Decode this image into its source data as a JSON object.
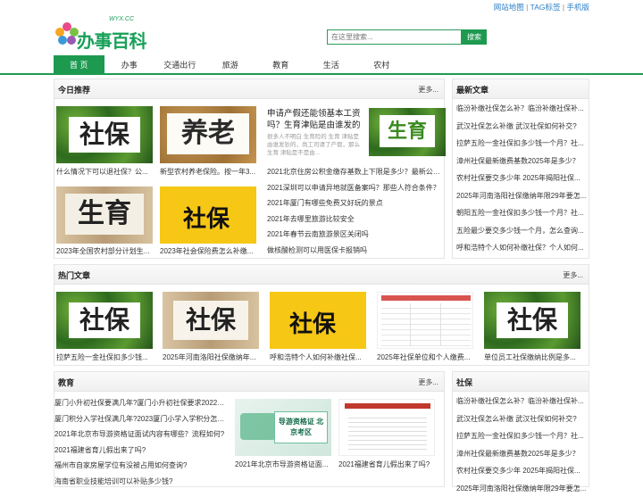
{
  "toplinks": {
    "sitemap": "网站地图",
    "tags": "TAG标签",
    "mobile": "手机版",
    "sep": "|"
  },
  "logo": {
    "text": "办事百科",
    "domain": "WYX.CC"
  },
  "search": {
    "placeholder": "在这里搜索...",
    "button": "搜索"
  },
  "nav": [
    "首 页",
    "办事",
    "交通出行",
    "旅游",
    "教育",
    "生活",
    "农村"
  ],
  "today": {
    "title": "今日推荐",
    "more": "更多...",
    "thumbs": [
      {
        "word": "社保",
        "caption": "什么情况下可以退社保？公..."
      },
      {
        "word": "养老",
        "caption": "新型农村养老保险。按一年3..."
      },
      {
        "word": "生育",
        "caption": "2023年全国农村部分计划生..."
      },
      {
        "word": "社保",
        "caption": "2023年社会保险费怎么补缴..."
      }
    ],
    "featured": {
      "title": "申请产假还能领基本工资吗？生育津贴是由谁发的哪",
      "summary": "很多人不明白 生育险的 生育 津贴是由谁发钞的，尚工司请了产假，那么 生育 津贴是不是由...",
      "word": "生育"
    },
    "list": [
      "2021北京住房公积金缴存基数上下限是多少？最新公积...",
      "2021深圳可以申请异地就医备案吗？那些人符合条件？",
      "2021年厦门有哪些免费又好玩的景点",
      "2021年去哪里旅游比较安全",
      "2021年春节云南旅游景区关闭吗",
      "做核酸检测可以用医保卡报销吗"
    ]
  },
  "latest": {
    "title": "最新文章",
    "list": [
      "临汾补缴社保怎么补？临汾补缴社保补...",
      "武汉社保怎么补缴 武汉社保如何补交?",
      "拉萨五险一金社保扣多少钱一个月？社...",
      "漳州社保最新缴费基数2025年是多少？",
      "农村社保要交多少年 2025年揭阳社保...",
      "2025年河南洛阳社保缴纳年限29年要怎...",
      "朝阳五险一金社保扣多少钱一个月？社...",
      "五险最少要交多少钱一个月，怎么查询...",
      "呼和浩特个人如何补缴社保？个人如何..."
    ]
  },
  "hot": {
    "title": "热门文章",
    "more": "更多...",
    "items": [
      {
        "word": "社保",
        "caption": "拉萨五险一金社保扣多少钱..."
      },
      {
        "word": "社保",
        "caption": "2025年河南洛阳社保缴纳年..."
      },
      {
        "word": "社保",
        "caption": "呼和浩特个人如何补缴社保..."
      },
      {
        "word": "",
        "caption": "2025年社保单位和个人缴费..."
      },
      {
        "word": "社保",
        "caption": "单位员工社保缴纳比例是多..."
      }
    ]
  },
  "edu": {
    "title": "教育",
    "more": "更多...",
    "list": [
      "厦门小升初社保要满几年?厦门小升初社保要求2022（...",
      "厦门积分入学社保满几年?2023厦门小学入学积分怎么...",
      "2021年北京市导游资格证面试内容有哪些？流程如何?",
      "2021福建省育儿假出来了吗?",
      "福州市自家房屋学位有没被占用如何查询?",
      "海南省职业技能培训可以补贴多少钱?"
    ],
    "thumbs": [
      {
        "sign": "导游资格证 北京考区",
        "caption": "2021年北京市导游资格证面..."
      },
      {
        "caption": "2021福建省育儿假出来了吗?"
      }
    ]
  },
  "shebao": {
    "title": "社保",
    "list": [
      "临汾补缴社保怎么补？临汾补缴社保补...",
      "武汉社保怎么补缴 武汉社保如何补交?",
      "拉萨五险一金社保扣多少钱一个月？社...",
      "漳州社保最新缴费基数2025年是多少？",
      "农村社保要交多少年 2025年揭阳社保...",
      "2025年河南洛阳社保缴纳年限29年要怎..."
    ]
  }
}
